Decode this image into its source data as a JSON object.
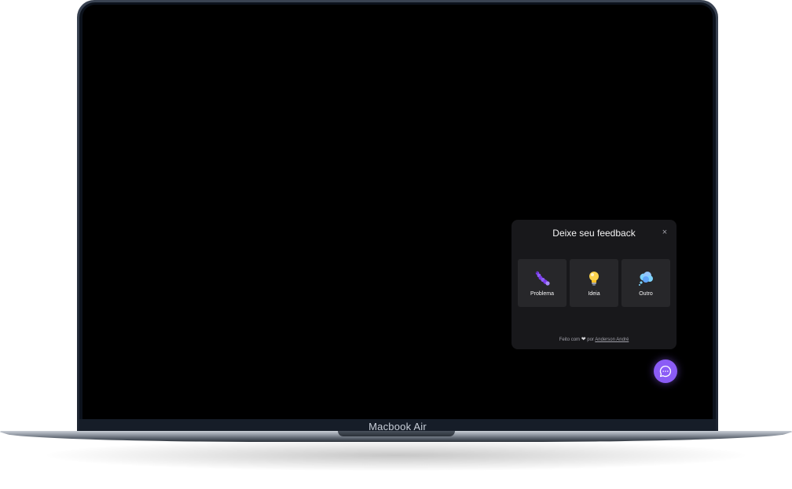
{
  "device": {
    "brand_label": "Macbook Air"
  },
  "widget": {
    "title": "Deixe seu feedback",
    "close_icon": "×",
    "options": [
      {
        "label": "Problema",
        "icon": "bug-icon"
      },
      {
        "label": "Ideia",
        "icon": "lightbulb-icon"
      },
      {
        "label": "Outro",
        "icon": "thought-bubble-icon"
      }
    ],
    "footer": {
      "prefix": "Feito com",
      "heart": "❤",
      "middle": "por",
      "author": "Anderson André"
    }
  },
  "fab": {
    "icon": "chat-icon"
  },
  "colors": {
    "accent": "#8b5cf6",
    "widget_bg": "#18181b",
    "option_bg": "#27272a"
  }
}
